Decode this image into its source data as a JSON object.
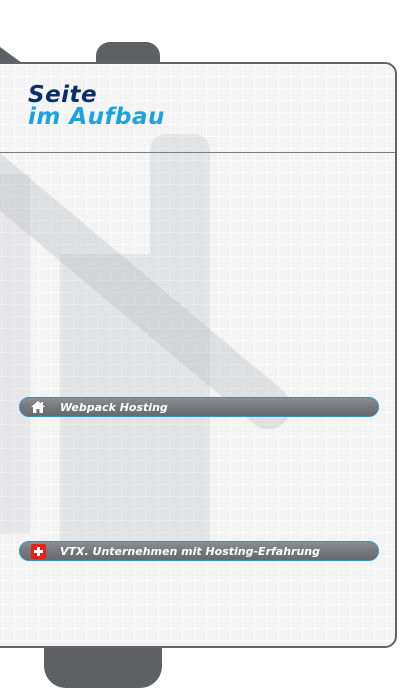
{
  "page": {
    "title_line1": "Seite",
    "title_line2": "im Aufbau"
  },
  "links": [
    {
      "label": "Webpack Hosting",
      "icon": "home-icon"
    },
    {
      "label": "VTX. Unternehmen mit Hosting-Erfahrung",
      "icon": "swiss-flag-icon"
    }
  ],
  "colors": {
    "title_dark": "#0b2f6b",
    "title_accent": "#1ba3dc",
    "frame": "#626368",
    "link_border": "#3b8fc2",
    "swiss_red": "#e2231a"
  }
}
